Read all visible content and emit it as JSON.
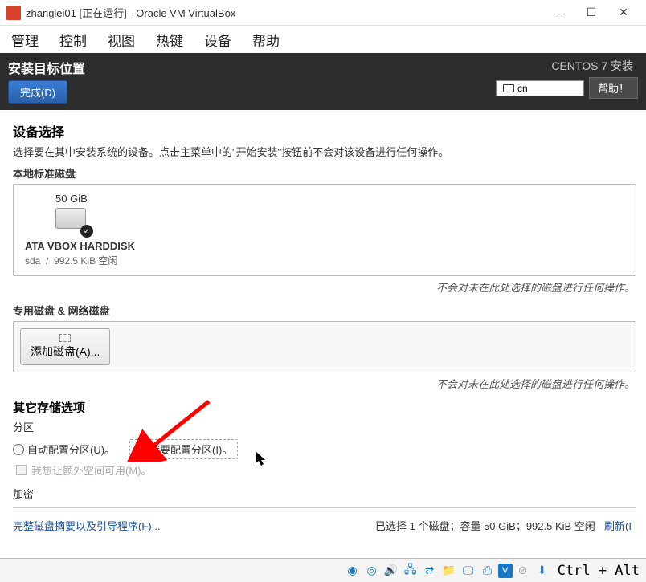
{
  "window": {
    "title": "zhanglei01 [正在运行] - Oracle VM VirtualBox"
  },
  "menubar": [
    "管理",
    "控制",
    "视图",
    "热键",
    "设备",
    "帮助"
  ],
  "installer_header": {
    "title": "安装目标位置",
    "done_label": "完成(D)",
    "right_text": "CENTOS 7 安装",
    "kb_layout": "cn",
    "help_label": "帮助！"
  },
  "device_select": {
    "title": "设备选择",
    "desc": "选择要在其中安装系统的设备。点击主菜单中的\"开始安装\"按钮前不会对该设备进行任何操作。",
    "local_disks_label": "本地标准磁盘",
    "disk": {
      "size": "50 GiB",
      "name": "ATA VBOX HARDDISK",
      "dev": "sda",
      "sep": "/",
      "free": "992.5 KiB 空闲"
    },
    "note": "不会对未在此处选择的磁盘进行任何操作。",
    "special_label": "专用磁盘 & 网络磁盘",
    "add_disk_label": "添加磁盘(A)..."
  },
  "storage_options": {
    "title": "其它存储选项",
    "partition_label": "分区",
    "auto_label": "自动配置分区(U)。",
    "manual_label": "我要配置分区(I)。",
    "extra_space_label": "我想让额外空间可用(M)。",
    "encrypt_label": "加密"
  },
  "footer": {
    "link": "完整磁盘摘要以及引导程序(F)...",
    "status": "已选择 1 个磁盘；容量 50 GiB；992.5 KiB 空闲",
    "refresh": "刷新(I"
  },
  "vm_status": {
    "hostkey": "Ctrl + Alt"
  }
}
